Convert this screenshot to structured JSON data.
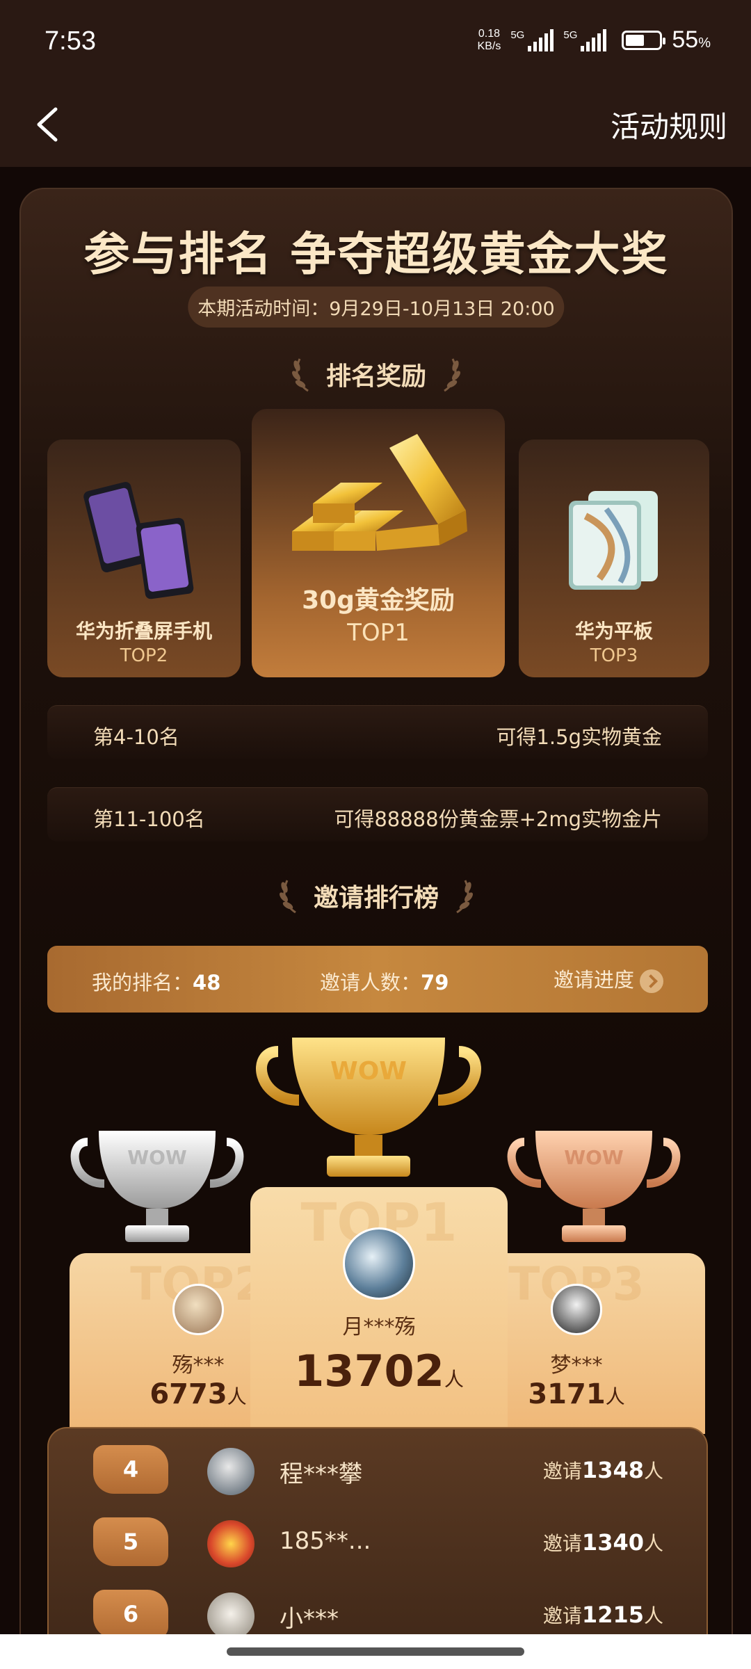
{
  "status_bar": {
    "time": "7:53",
    "net_speed_value": "0.18",
    "net_speed_unit": "KB/s",
    "sim1_label": "5G",
    "sim2_label": "5G",
    "battery_percent": "55",
    "battery_unit": "%",
    "battery_level": 0.55
  },
  "nav": {
    "back_icon": "chevron-left-icon",
    "rules_label": "活动规则"
  },
  "hero": {
    "headline": "参与排名 争夺超级黄金大奖",
    "period": "本期活动时间：9月29日-10月13日 20:00"
  },
  "prizes": {
    "section_title": "排名奖励",
    "items": [
      {
        "name": "华为折叠屏手机",
        "rank": "TOP2",
        "icon": "foldable-phone-icon"
      },
      {
        "name": "30g黄金奖励",
        "rank": "TOP1",
        "icon": "gold-bars-icon"
      },
      {
        "name": "华为平板",
        "rank": "TOP3",
        "icon": "tablet-icon"
      }
    ]
  },
  "rewards": [
    {
      "range": "第4-10名",
      "reward": "可得1.5g实物黄金"
    },
    {
      "range": "第11-100名",
      "reward": "可得88888份黄金票+2mg实物金片"
    }
  ],
  "leaderboard": {
    "section_title": "邀请排行榜",
    "my_rank_label": "我的排名：",
    "my_rank_value": "48",
    "invite_count_label": "邀请人数：",
    "invite_count_value": "79",
    "progress_label": "邀请进度",
    "trophy_text": "WOW",
    "podium": [
      {
        "rank": "TOP2",
        "name": "殇***",
        "count": "6773",
        "unit": "人"
      },
      {
        "rank": "TOP1",
        "name": "月***殇",
        "count": "13702",
        "unit": "人"
      },
      {
        "rank": "TOP3",
        "name": "梦***",
        "count": "3171",
        "unit": "人"
      }
    ],
    "list": [
      {
        "rank": "4",
        "name": "程***攀",
        "prefix": "邀请",
        "count": "1348",
        "unit": "人"
      },
      {
        "rank": "5",
        "name": "185**...",
        "prefix": "邀请",
        "count": "1340",
        "unit": "人"
      },
      {
        "rank": "6",
        "name": "小***",
        "prefix": "邀请",
        "count": "1215",
        "unit": "人"
      }
    ]
  },
  "colors": {
    "background": "#120806",
    "accent_gold": "#c6883f",
    "text_cream": "#f6e3c7"
  }
}
